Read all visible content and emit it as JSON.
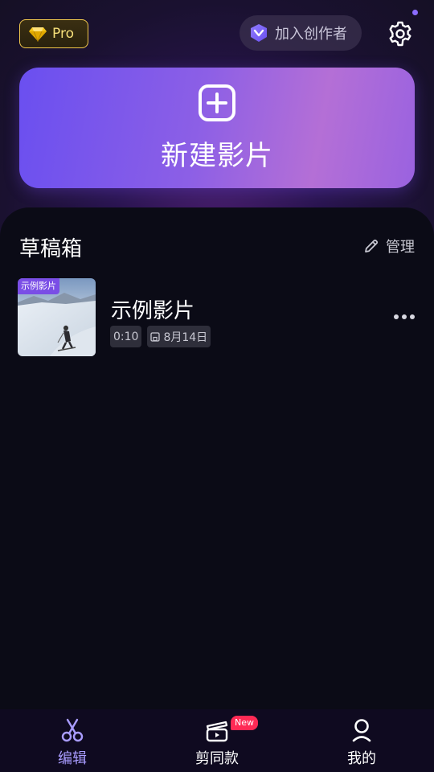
{
  "header": {
    "pro_label": "Pro",
    "creator_label": "加入创作者"
  },
  "new_movie": {
    "label": "新建影片"
  },
  "drafts": {
    "title": "草稿箱",
    "manage_label": "管理",
    "items": [
      {
        "tag": "示例影片",
        "title": "示例影片",
        "duration": "0:10",
        "date": "8月14日"
      }
    ]
  },
  "tabbar": {
    "tabs": [
      {
        "label": "编辑",
        "icon": "scissors-icon",
        "active": true
      },
      {
        "label": "剪同款",
        "icon": "template-icon",
        "badge": "New"
      },
      {
        "label": "我的",
        "icon": "profile-icon"
      }
    ]
  },
  "colors": {
    "accent": "#7a4ee6",
    "pro_gold": "#f2c94c",
    "new_badge": "#ff2a55",
    "active_tab": "#a99cff"
  }
}
